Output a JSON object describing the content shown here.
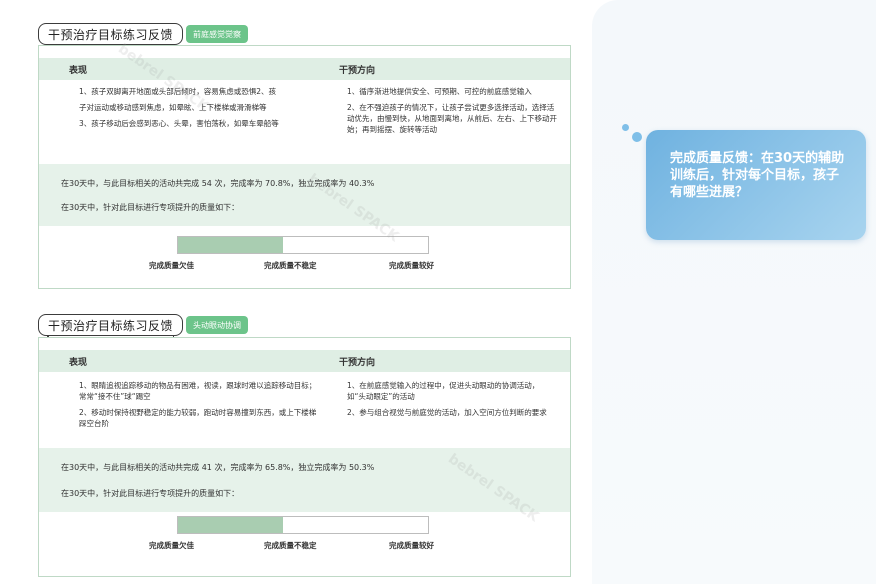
{
  "sections": [
    {
      "title": "干预治疗目标练习反馈",
      "tag": "前庭感觉觉察",
      "header_behavior": "表现",
      "header_direction": "干预方向",
      "behaviors": [
        "1、孩子双脚离开地面或头部后倾时，容易焦虑或恐惧2、孩",
        "子对运动或移动感到焦虑，如晕眩、上下楼梯或滑滑梯等",
        "3、孩子移动后会感到恶心、头晕，害怕荡秋，如晕车晕船等"
      ],
      "directions": [
        "1、循序渐进地提供安全、可预期、可控的前庭感觉输入",
        "2、在不强迫孩子的情况下，让孩子尝试更多选择活动，选择活动优先，由慢到快，从地面到离地，从前后、左右、上下移动开始；再到摇摆、旋转等活动"
      ],
      "stat_line": "在30天中，与此目标相关的活动共完成 54 次，完成率为 70.8%，独立完成率为 40.3%",
      "quality_line": "在30天中，针对此目标进行专项提升的质量如下：",
      "progress": 0.42,
      "quality_labels": [
        "完成质量欠佳",
        "完成质量不稳定",
        "完成质量较好"
      ]
    },
    {
      "title": "干预治疗目标练习反馈",
      "tag": "头动眼动协调",
      "header_behavior": "表现",
      "header_direction": "干预方向",
      "behaviors": [
        "1、眼睛追视追踪移动的物品有困难，视读，跟球时难以追踪移动目标；常常“接不住”球“踢空",
        "2、移动时保持视野稳定的能力较弱，跑动时容易撞到东西，或上下楼梯踩空台阶"
      ],
      "directions": [
        "1、在前庭感觉输入的过程中，促进头动眼动的协调活动，如“头动眼定”的活动",
        "2、参与组合视觉与前庭觉的活动，加入空间方位判断的要求"
      ],
      "stat_line": "在30天中，与此目标相关的活动共完成 41 次，完成率为 65.8%，独立完成率为 50.3%",
      "quality_line": "在30天中，针对此目标进行专项提升的质量如下：",
      "progress": 0.42,
      "quality_labels": [
        "完成质量欠佳",
        "完成质量不稳定",
        "完成质量较好"
      ]
    }
  ],
  "callout": {
    "text": "完成质量反馈：在30天的辅助训练后，针对每个目标，孩子有哪些进展？"
  },
  "colors": {
    "accent_green": "#6cc48a",
    "header_green": "#dfeee4",
    "progress_fill": "#a9cdb1",
    "callout_blue": "#6fb2e0"
  },
  "watermark": "bebrel SPACK"
}
